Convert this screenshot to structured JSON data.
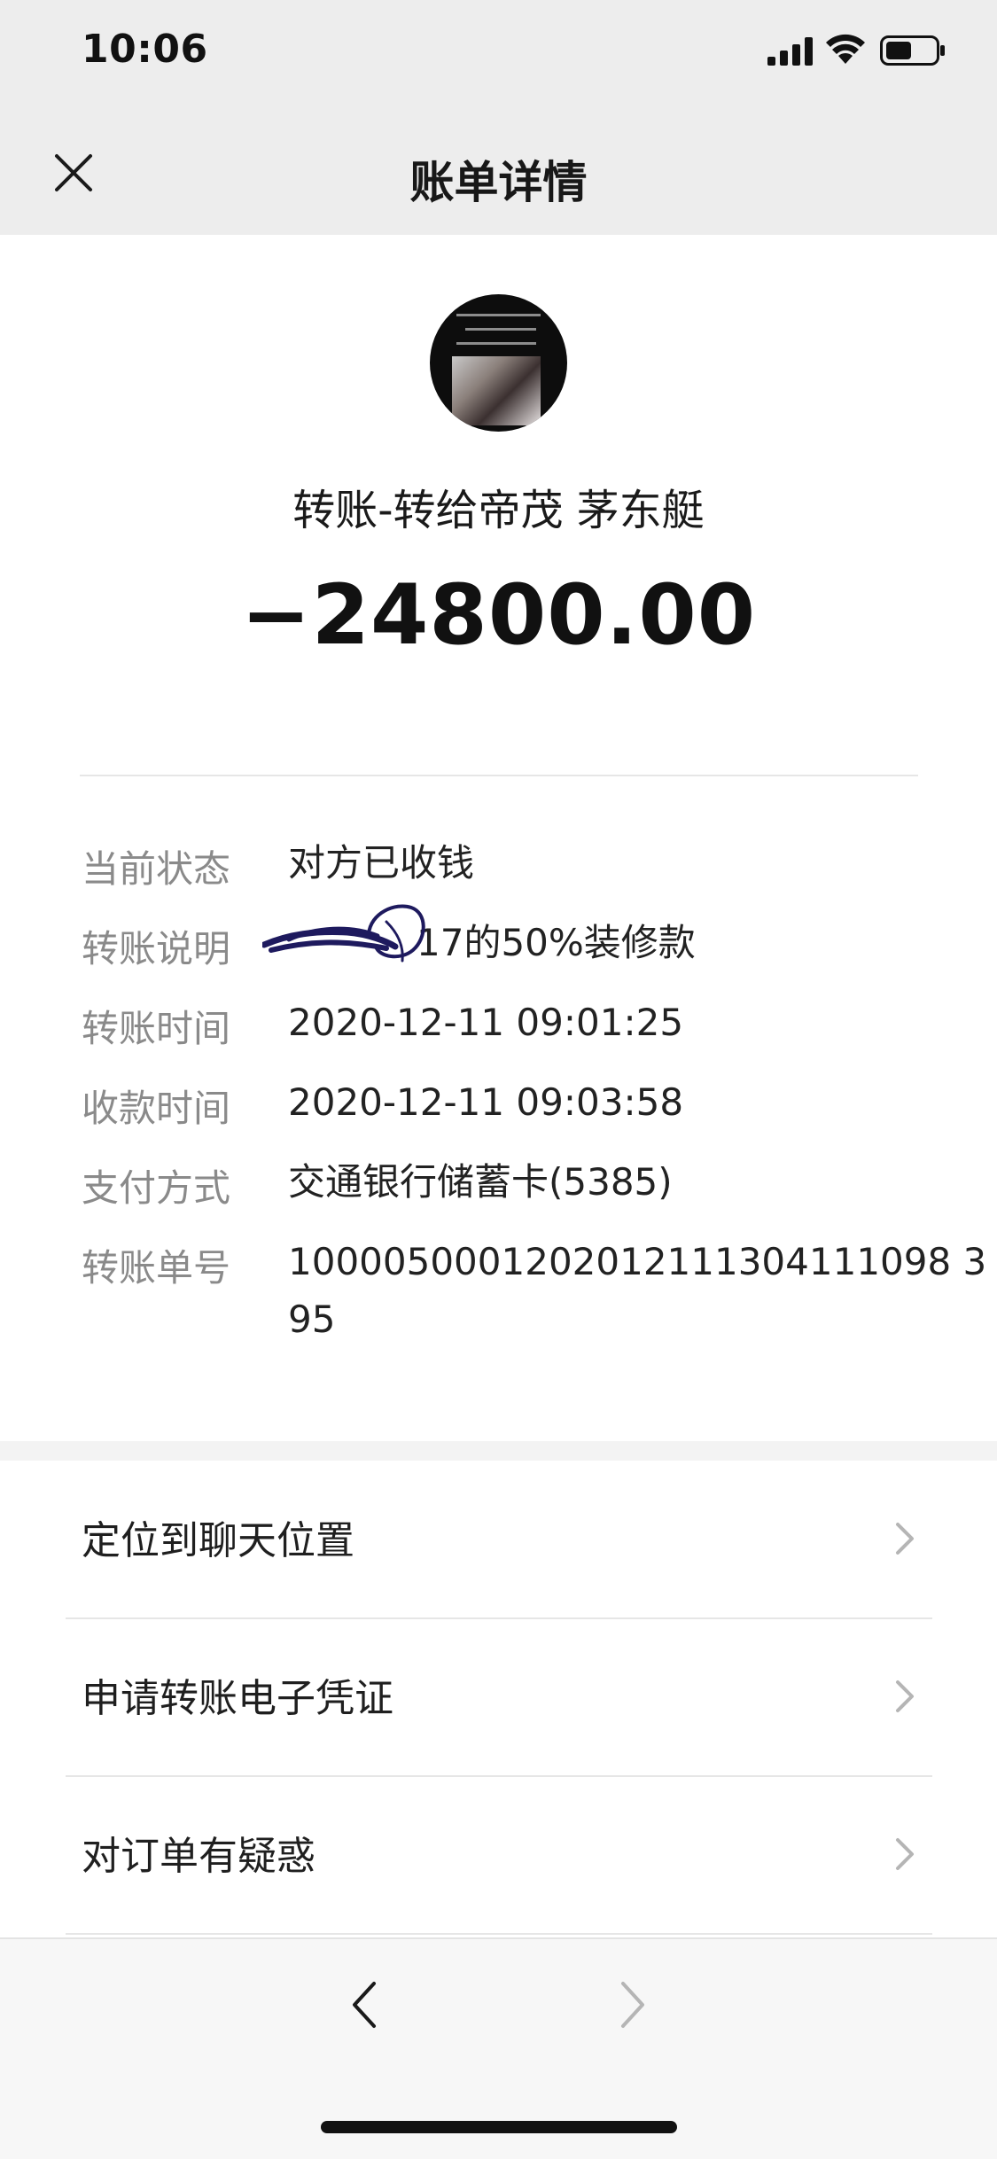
{
  "status_bar": {
    "time": "10:06",
    "icons": [
      "signal-icon",
      "wifi-icon",
      "battery-icon"
    ]
  },
  "navbar": {
    "title": "账单详情",
    "close_icon": "close-icon"
  },
  "summary": {
    "transfer_title": "转账-转给帝茂 茅东艇",
    "amount": "−24800.00"
  },
  "details": [
    {
      "label": "当前状态",
      "value": "对方已收钱"
    },
    {
      "label": "转账说明",
      "value": "17的50%装修款"
    },
    {
      "label": "转账时间",
      "value": "2020-12-11 09:01:25"
    },
    {
      "label": "收款时间",
      "value": "2020-12-11 09:03:58"
    },
    {
      "label": "支付方式",
      "value": "交通银行储蓄卡(5385)"
    },
    {
      "label": "转账单号",
      "value_line1": "1000050001202012111304111098 3",
      "value_line2": "95"
    }
  ],
  "menu": [
    {
      "label": "定位到聊天位置"
    },
    {
      "label": "申请转账电子凭证"
    },
    {
      "label": "对订单有疑惑"
    }
  ],
  "bottom_bar": {
    "back_icon": "back-arrow-icon",
    "forward_icon": "forward-arrow-icon"
  },
  "colors": {
    "header_bg": "#ededed",
    "label_gray": "#8a8a8a",
    "text_dark": "#1b1b1b",
    "scribble_ink": "#1e1a5e"
  }
}
